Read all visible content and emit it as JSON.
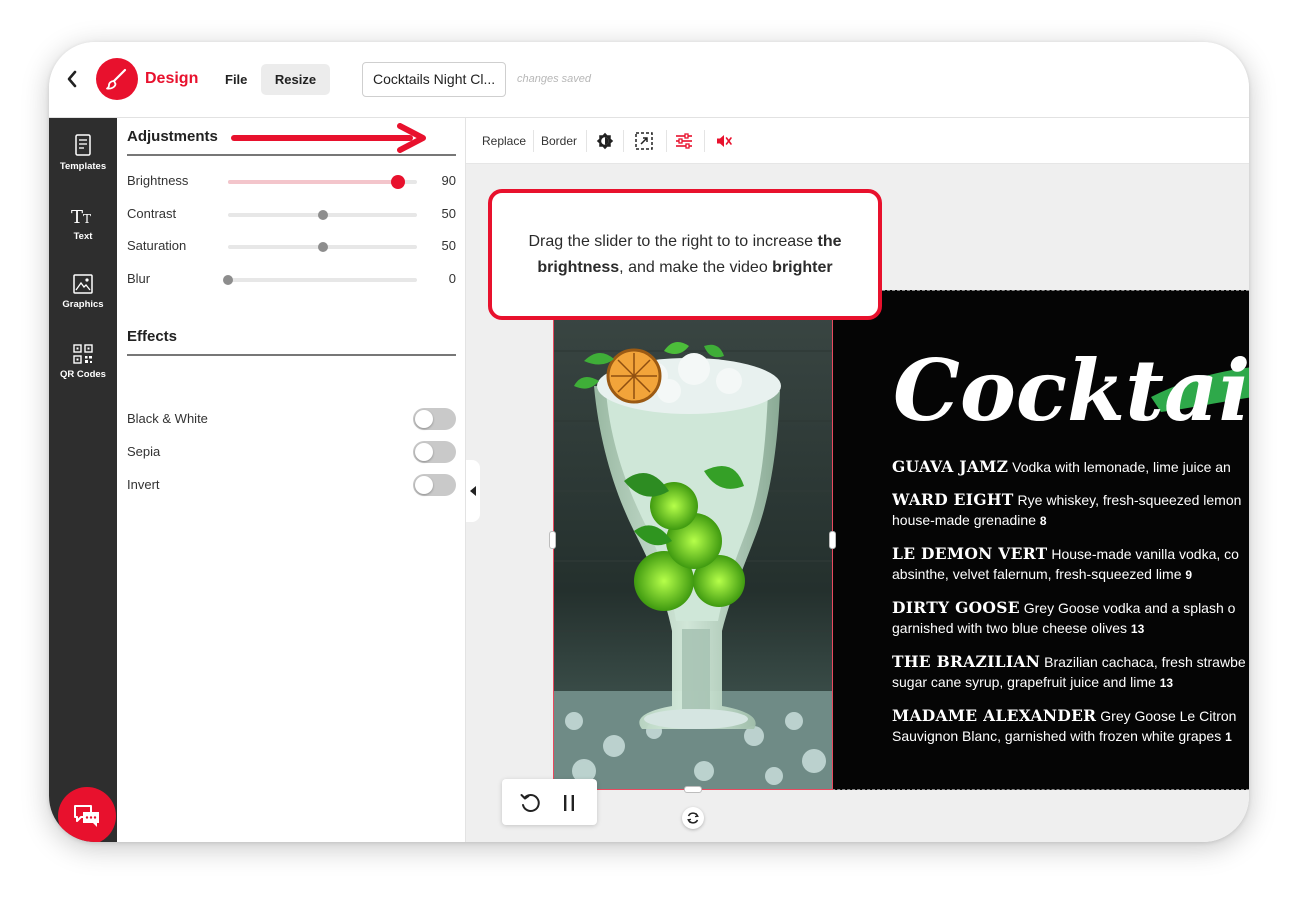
{
  "app": {
    "brand": "Design",
    "file_label": "File",
    "resize_label": "Resize",
    "design_title": "Cocktails Night Cl...",
    "save_status": "changes saved",
    "accent": "#e8112d"
  },
  "sidebar": {
    "items": [
      {
        "label": "Templates",
        "icon": "templates-icon"
      },
      {
        "label": "Text",
        "icon": "text-icon"
      },
      {
        "label": "Graphics",
        "icon": "graphics-icon"
      },
      {
        "label": "QR Codes",
        "icon": "qr-code-icon"
      }
    ]
  },
  "adjustments": {
    "title": "Adjustments",
    "items": [
      {
        "label": "Brightness",
        "value": 90,
        "display": "90",
        "active": true
      },
      {
        "label": "Contrast",
        "value": 50,
        "display": "50",
        "active": false
      },
      {
        "label": "Saturation",
        "value": 50,
        "display": "50",
        "active": false
      },
      {
        "label": "Blur",
        "value": 0,
        "display": "0",
        "active": false
      }
    ]
  },
  "effects": {
    "title": "Effects",
    "items": [
      {
        "label": "Black & White",
        "on": false
      },
      {
        "label": "Sepia",
        "on": false
      },
      {
        "label": "Invert",
        "on": false
      }
    ]
  },
  "toolbar": {
    "replace_label": "Replace",
    "border_label": "Border",
    "icons": [
      "brightness-icon",
      "crop-icon",
      "adjust-sliders-icon",
      "mute-icon"
    ]
  },
  "callout": {
    "line1": "Drag the slider to the right  to to increase",
    "bold1": "the",
    "bold2": "brightness",
    "line2": ", and make the video",
    "bold3": "brighter"
  },
  "menu": {
    "title": "Cocktails",
    "items": [
      {
        "name": "GUAVA JAMZ",
        "desc1": " Vodka with lemonade, lime juice an",
        "desc2": "",
        "price": ""
      },
      {
        "name": "WARD EIGHT",
        "desc1": " Rye whiskey, fresh-squeezed lemon",
        "desc2": "house-made grenadine ",
        "price": "8"
      },
      {
        "name": "LE DEMON VERT",
        "desc1": " House-made vanilla vodka, co",
        "desc2": "absinthe, velvet falernum, fresh-squeezed lime ",
        "price": "9"
      },
      {
        "name": "DIRTY GOOSE",
        "desc1": " Grey Goose vodka and a splash o",
        "desc2": "garnished with two blue cheese olives ",
        "price": "13"
      },
      {
        "name": "THE BRAZILIAN",
        "desc1": " Brazilian cachaca, fresh strawbe",
        "desc2": "sugar cane syrup, grapefruit juice and lime ",
        "price": "13"
      },
      {
        "name": "MADAME ALEXANDER",
        "desc1": " Grey Goose Le Citron",
        "desc2": "Sauvignon Blanc, garnished with frozen white grapes ",
        "price": "1"
      }
    ]
  }
}
